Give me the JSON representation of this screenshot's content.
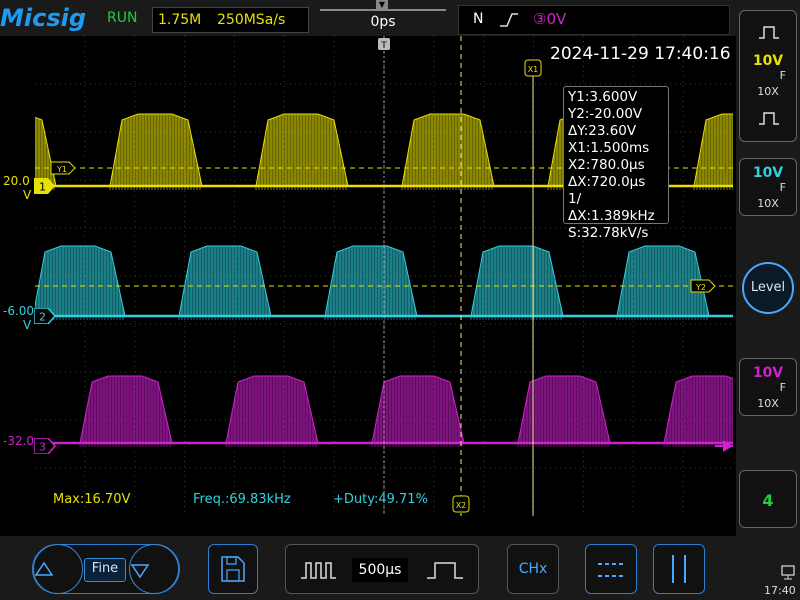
{
  "header": {
    "logo": "Micsig",
    "run_state": "RUN",
    "memory_depth": "1.75M",
    "sample_rate": "250MSa/s",
    "delay": "0ps",
    "trigger_mode": "N",
    "trigger_slope": "_/",
    "trigger_source": "③0V"
  },
  "datetime": "2024-11-29 17:40:16",
  "cursor_readout": {
    "lines": [
      "Y1:3.600V",
      "Y2:-20.00V",
      "ΔY:23.60V",
      "X1:1.500ms",
      "X2:780.0μs",
      "ΔX:720.0μs",
      "1/ΔX:1.389kHz",
      "S:32.78kV/s"
    ]
  },
  "cursor_tags": {
    "x1": "X1",
    "x2": "X2",
    "y1": "Y1",
    "y2": "Y2",
    "t": "T"
  },
  "channels": [
    {
      "id": "1",
      "offset_label": "20.0",
      "unit": "V",
      "color": "#e8e000",
      "scale": "10V",
      "probe": "10X",
      "coupling": "F"
    },
    {
      "id": "2",
      "offset_label": "-6.00",
      "unit": "V",
      "color": "#30d0e0",
      "scale": "10V",
      "probe": "10X",
      "coupling": "F"
    },
    {
      "id": "3",
      "offset_label": "-32.0",
      "unit": "V",
      "color": "#d020d0",
      "scale": "10V",
      "probe": "10X"
    }
  ],
  "measurements": {
    "m1": "Max:16.70V",
    "m2": "Freq.:69.83kHz",
    "m3": "+Duty:49.71%"
  },
  "right_panel": {
    "level_label": "Level",
    "ch4_label": "4"
  },
  "bottom": {
    "fine_label": "Fine",
    "timebase": "500μs",
    "chx_label": "CHx",
    "clock": "17:40"
  },
  "colors": {
    "ch1": "#e8e000",
    "ch2": "#30d0e0",
    "ch3": "#d020d0",
    "accent": "#2a7fd4"
  }
}
